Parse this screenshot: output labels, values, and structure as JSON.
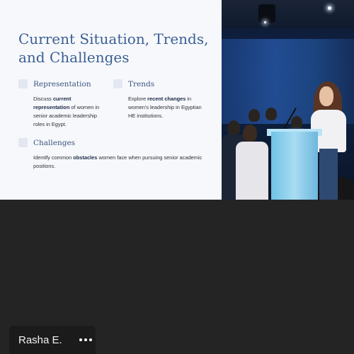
{
  "slide": {
    "title": "Current Situation, Trends, and Challenges",
    "representation": {
      "label": "Representation",
      "pre": "Discuss ",
      "bold": "current representation",
      "post": " of women in senior academic leadership roles in Egypt."
    },
    "trends": {
      "label": "Trends",
      "pre": "Explore ",
      "bold": "recent changes",
      "post": " in women's leadership in Egyptian HE institutions."
    },
    "challenges": {
      "label": "Challenges",
      "pre": "Identify common ",
      "bold": "obstacles",
      "post": " women face when pursuing senior academic positions."
    }
  },
  "participant": {
    "name": "Rasha E."
  },
  "colors": {
    "title": "#3b5f95",
    "meeting_background": "#242424",
    "podium": "#8fd0ee"
  }
}
